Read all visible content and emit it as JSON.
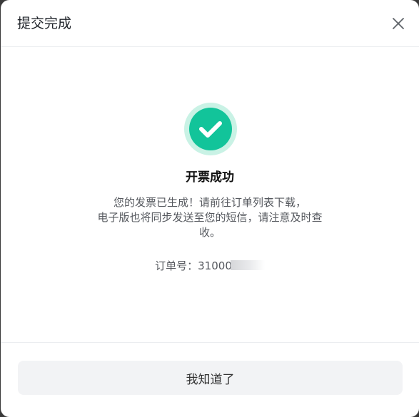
{
  "dialog": {
    "title": "提交完成",
    "close_icon": "close-icon"
  },
  "result": {
    "icon": "check-circle-icon",
    "accent_color": "#12c49a",
    "title": "开票成功",
    "description_lines": [
      "您的发票已生成！请前往订单列表下载，",
      "电子版也将同步发送至您的短信，请注意及时查",
      "收。"
    ],
    "order_label": "订单号：",
    "order_number_visible": "31000"
  },
  "footer": {
    "ok_label": "我知道了"
  }
}
